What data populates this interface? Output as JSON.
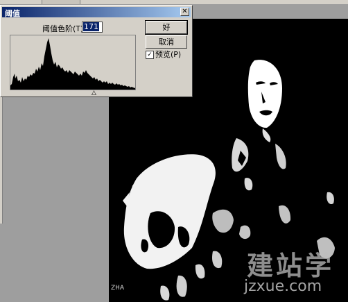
{
  "dialog": {
    "title": "阈值",
    "close_glyph": "✕",
    "level_label": "阈值色阶(T):",
    "level_value": "171",
    "ok_label": "好",
    "cancel_label": "取消",
    "preview_label": "预览(P)",
    "preview_checked": "✓",
    "slider_glyph": "△"
  },
  "watermark": {
    "text": "建站学",
    "url": "jzxue.com"
  },
  "cover_text": "ZHA"
}
